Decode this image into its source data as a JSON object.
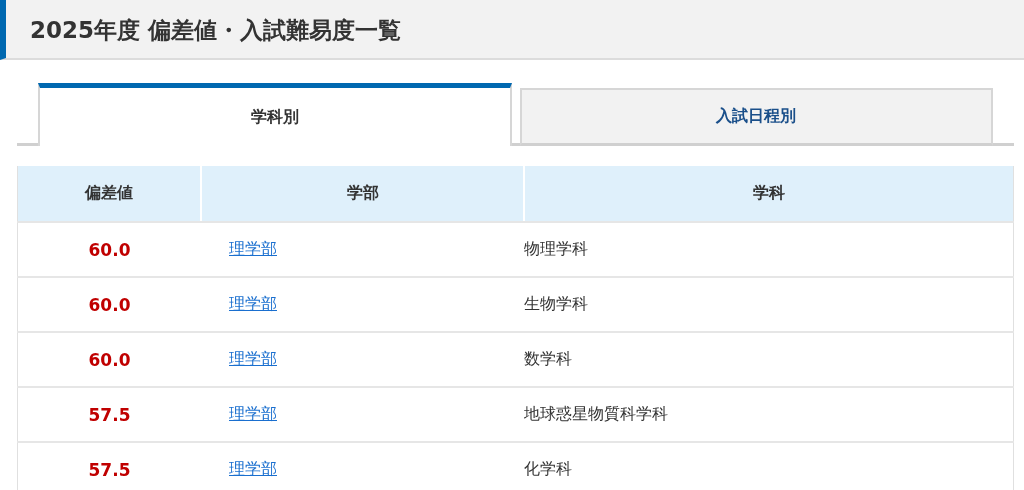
{
  "title": "2025年度 偏差値・入試難易度一覧",
  "tabs": [
    {
      "label": "学科別",
      "selected": true
    },
    {
      "label": "入試日程別",
      "selected": false
    }
  ],
  "table": {
    "columns": [
      "偏差値",
      "学部",
      "学科"
    ],
    "rows": [
      {
        "score": "60.0",
        "faculty": "理学部",
        "department": "物理学科"
      },
      {
        "score": "60.0",
        "faculty": "理学部",
        "department": "生物学科"
      },
      {
        "score": "60.0",
        "faculty": "理学部",
        "department": "数学科"
      },
      {
        "score": "57.5",
        "faculty": "理学部",
        "department": "地球惑星物質科学科"
      },
      {
        "score": "57.5",
        "faculty": "理学部",
        "department": "化学科"
      }
    ]
  }
}
